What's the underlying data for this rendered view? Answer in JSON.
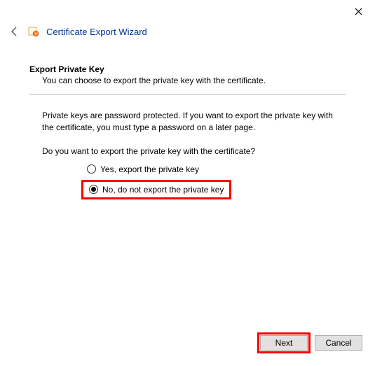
{
  "window": {
    "title": "Certificate Export Wizard"
  },
  "section": {
    "title": "Export Private Key",
    "description": "You can choose to export the private key with the certificate."
  },
  "info": "Private keys are password protected. If you want to export the private key with the certificate, you must type a password on a later page.",
  "question": "Do you want to export the private key with the certificate?",
  "options": {
    "yes": "Yes, export the private key",
    "no": "No, do not export the private key"
  },
  "buttons": {
    "next": "Next",
    "cancel": "Cancel"
  }
}
